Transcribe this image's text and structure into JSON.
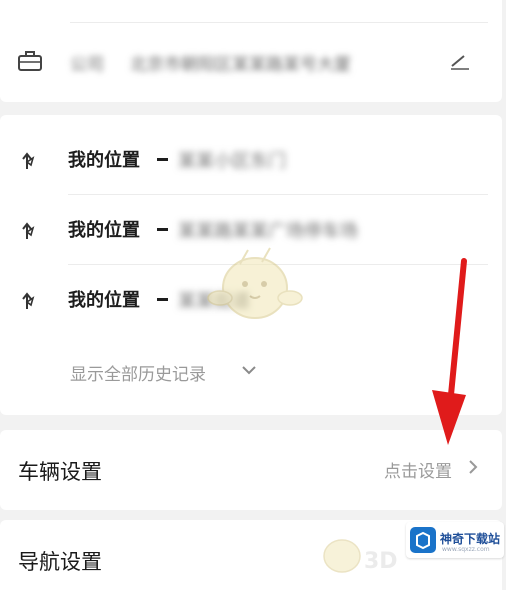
{
  "work": {
    "label_blurred": "公司",
    "address_blurred": "北京市朝阳区某某路某号大厦"
  },
  "history": {
    "items": [
      {
        "label": "我的位置",
        "dest_blurred": "某某小区东门"
      },
      {
        "label": "我的位置",
        "dest_blurred": "某某路某某广场停车场"
      },
      {
        "label": "我的位置",
        "dest_blurred": "某某街道"
      }
    ],
    "show_all": "显示全部历史记录"
  },
  "vehicle": {
    "title": "车辆设置",
    "action": "点击设置"
  },
  "navigation": {
    "title": "导航设置"
  },
  "watermark": {
    "name": "神奇下载站",
    "url": "www.sqxzz.com"
  },
  "colors": {
    "annotation_arrow": "#e01b1b",
    "watermark_blue": "#1a73c9"
  }
}
